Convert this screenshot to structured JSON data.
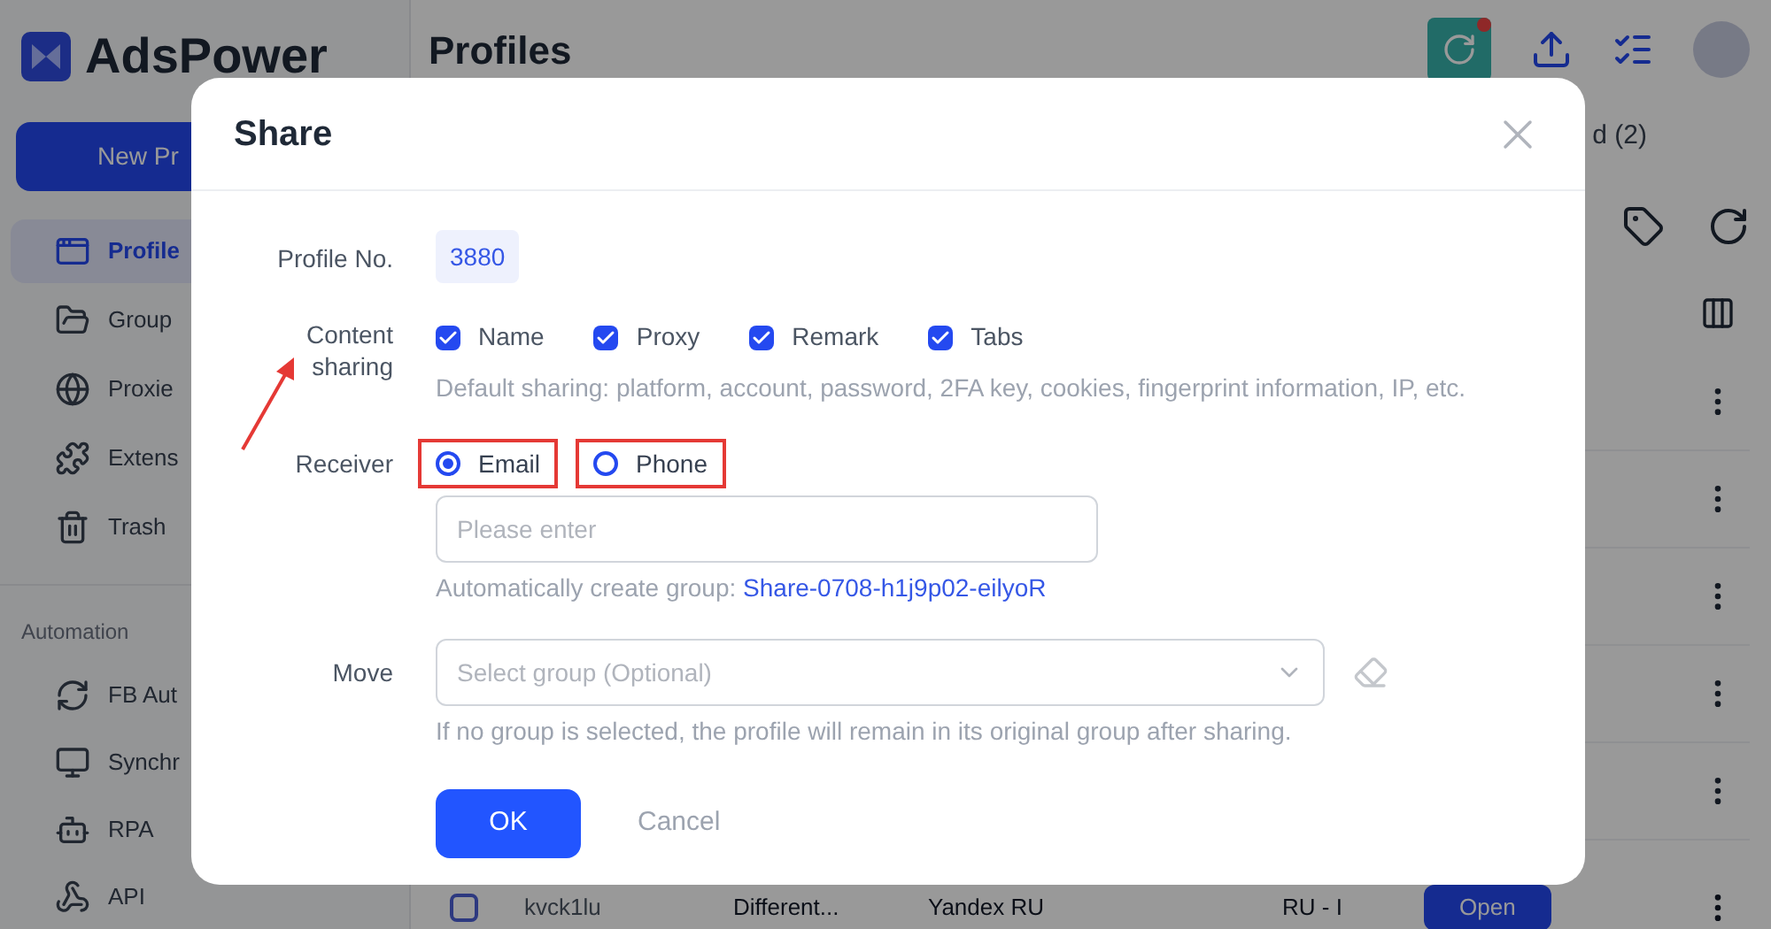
{
  "app": {
    "logo": "AdsPower",
    "new_button": "New Pr",
    "nav": [
      {
        "label": "Profile",
        "selected": true
      },
      {
        "label": "Group",
        "selected": false
      },
      {
        "label": "Proxie",
        "selected": false
      },
      {
        "label": "Extens",
        "selected": false
      },
      {
        "label": "Trash",
        "selected": false
      }
    ],
    "section": "Automation",
    "automation": [
      {
        "label": "FB Aut"
      },
      {
        "label": "Synchr"
      },
      {
        "label": "RPA"
      },
      {
        "label": "API"
      }
    ],
    "page_title": "Profiles",
    "tab_fragment": "d (2)",
    "last_row": {
      "checked": false,
      "name": "kvck1lu",
      "column_2": "Different...",
      "proxy": "Yandex RU",
      "column_4": "RU - I",
      "open": "Open"
    }
  },
  "dialog": {
    "title": "Share",
    "profile_label": "Profile No.",
    "profile_no": "3880",
    "content_label": "Content sharing",
    "options": [
      {
        "label": "Name",
        "checked": true
      },
      {
        "label": "Proxy",
        "checked": true
      },
      {
        "label": "Remark",
        "checked": true
      },
      {
        "label": "Tabs",
        "checked": true
      }
    ],
    "default_hint": "Default sharing: platform, account, password, 2FA key, cookies, fingerprint information, IP, etc.",
    "receiver_label": "Receiver",
    "receivers": [
      {
        "label": "Email",
        "selected": true,
        "highlighted": true
      },
      {
        "label": "Phone",
        "selected": false,
        "highlighted": true
      }
    ],
    "receiver_input": {
      "placeholder": "Please enter"
    },
    "group_hint": "Automatically create group:",
    "group_name": "Share-0708-h1j9p02-eilyoR",
    "move_label": "Move",
    "move_select": {
      "placeholder": "Select group (Optional)"
    },
    "move_hint": "If no group is selected, the profile will remain in its original group after sharing.",
    "ok": "OK",
    "cancel": "Cancel"
  }
}
